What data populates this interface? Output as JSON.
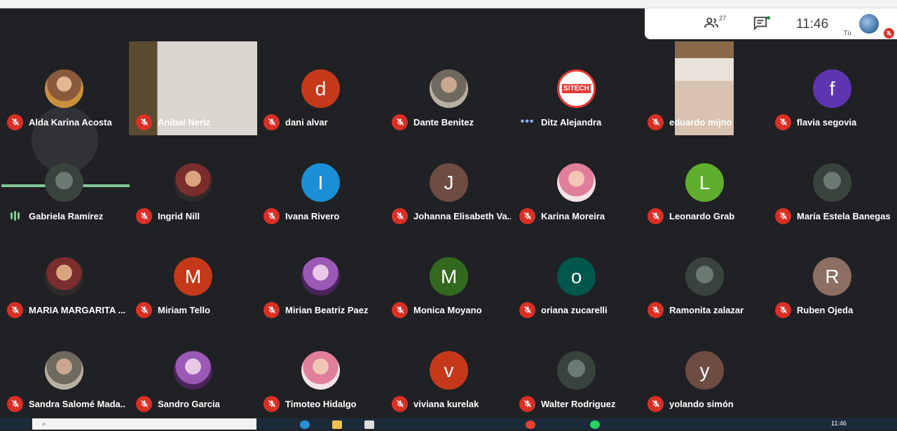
{
  "topbar": {
    "participant_count": "27",
    "time": "11:46",
    "self_label": "Tú"
  },
  "participants": [
    {
      "name": "Alda Karina Acosta",
      "status": "muted",
      "avatar": "photo"
    },
    {
      "name": "Anibal Neriz",
      "status": "muted",
      "avatar": "video"
    },
    {
      "name": "dani alvar",
      "status": "muted",
      "avatar": "letter",
      "letter": "d",
      "color": "#c5391a"
    },
    {
      "name": "Dante Benitez",
      "status": "muted",
      "avatar": "photo"
    },
    {
      "name": "Ditz Alejandra",
      "status": "connecting",
      "avatar": "logo",
      "logo_text": "SITECH"
    },
    {
      "name": "eduardo mijno",
      "status": "muted",
      "avatar": "video"
    },
    {
      "name": "flavia segovia",
      "status": "muted",
      "avatar": "letter",
      "letter": "f",
      "color": "#5e35b1"
    },
    {
      "name": "Gabriela Ramírez",
      "status": "speaking",
      "avatar": "photo"
    },
    {
      "name": "Ingrid Nill",
      "status": "muted",
      "avatar": "photo"
    },
    {
      "name": "Ivana Rivero",
      "status": "muted",
      "avatar": "letter",
      "letter": "I",
      "color": "#1a8fd6"
    },
    {
      "name": "Johanna Elisabeth Va...",
      "status": "muted",
      "avatar": "letter",
      "letter": "J",
      "color": "#6d4c41"
    },
    {
      "name": "Karina Moreira",
      "status": "muted",
      "avatar": "photo"
    },
    {
      "name": "Leonardo Grab",
      "status": "muted",
      "avatar": "letter",
      "letter": "L",
      "color": "#5fae2e"
    },
    {
      "name": "María Estela Banegas",
      "status": "muted",
      "avatar": "photo"
    },
    {
      "name": "MARIA MARGARITA ...",
      "status": "muted",
      "avatar": "photo"
    },
    {
      "name": "Miriam Tello",
      "status": "muted",
      "avatar": "letter",
      "letter": "M",
      "color": "#c5391a"
    },
    {
      "name": "Mirian Beatriz Paez",
      "status": "muted",
      "avatar": "photo"
    },
    {
      "name": "Monica Moyano",
      "status": "muted",
      "avatar": "letter",
      "letter": "M",
      "color": "#33691e"
    },
    {
      "name": "oriana zucarelli",
      "status": "muted",
      "avatar": "letter",
      "letter": "o",
      "color": "#00574b"
    },
    {
      "name": "Ramonita zalazar",
      "status": "muted",
      "avatar": "photo"
    },
    {
      "name": "Ruben Ojeda",
      "status": "muted",
      "avatar": "letter",
      "letter": "R",
      "color": "#8d6e63"
    },
    {
      "name": "Sandra Salomé Mada...",
      "status": "muted",
      "avatar": "photo"
    },
    {
      "name": "Sandro Garcia",
      "status": "muted",
      "avatar": "photo"
    },
    {
      "name": "Timoteo Hidalgo",
      "status": "muted",
      "avatar": "photo"
    },
    {
      "name": "viviana kurelak",
      "status": "muted",
      "avatar": "letter",
      "letter": "v",
      "color": "#c5391a"
    },
    {
      "name": "Walter Rodriguez",
      "status": "muted",
      "avatar": "photo"
    },
    {
      "name": "yolando simón",
      "status": "muted",
      "avatar": "letter",
      "letter": "y",
      "color": "#6d4c41"
    }
  ],
  "taskbar": {
    "time": "11:46"
  },
  "colors": {
    "background": "#202124",
    "mute_red": "#d93025",
    "speaking_green": "#81c995"
  }
}
